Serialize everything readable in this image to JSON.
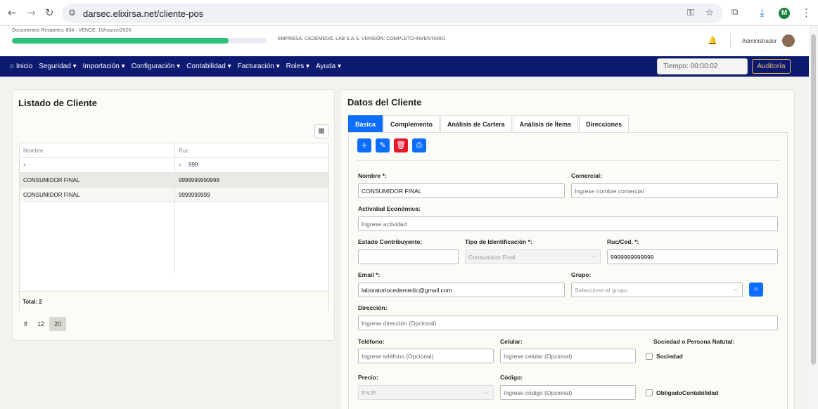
{
  "browser": {
    "url": "darsec.elixirsa.net/cliente-pos",
    "profile_initial": "M"
  },
  "header": {
    "docs_text": "Documentos Restantes: 834 - VENCE: 10/marzo/2026",
    "progress": 0.85,
    "empresa_text": "EMPRESA: CEDEMEDIC LAB S.A.S. VERSIÓN: COMPLETO-INVENTARIO",
    "user": "Administrador"
  },
  "nav": {
    "items": [
      "Inicio",
      "Seguridad",
      "Importación",
      "Configuración",
      "Contabilidad",
      "Facturación",
      "Roles",
      "Ayuda"
    ],
    "timer": "Tiempo: 00:00:02",
    "audit_label": "Auditoría"
  },
  "list": {
    "title": "Listado de Cliente",
    "columns": [
      "Nombre",
      "Ruc"
    ],
    "filter_ruc": "999",
    "rows": [
      {
        "nombre": "CONSUMIDOR FINAL",
        "ruc": "9999999999999"
      },
      {
        "nombre": "CONSUMIDOR FINAL",
        "ruc": "9999999999"
      }
    ],
    "total": "Total: 2",
    "page_sizes": [
      "8",
      "12",
      "20"
    ]
  },
  "form": {
    "title": "Datos del Cliente",
    "tabs": [
      "Básica",
      "Complemento",
      "Análisis de Cartera",
      "Análisis de Ítems",
      "Direcciones"
    ],
    "labels": {
      "nombre": "Nombre *:",
      "comercial": "Comercial:",
      "actividad": "Actividad Económica:",
      "estado": "Estado Contribuyente:",
      "tipo_id": "Tipo de Identificación *:",
      "ruc": "Ruc/Ced. *:",
      "email": "Email *:",
      "grupo": "Grupo:",
      "direccion": "Dirección:",
      "telefono": "Teléfono:",
      "celular": "Celular:",
      "sociedad_title": "Sociedad o Persona Natutal:",
      "sociedad": "Sociedad",
      "precio": "Precio:",
      "codigo": "Código:",
      "obligado": "ObligadoContabilidad"
    },
    "values": {
      "nombre": "CONSUMIDOR FINAL",
      "tipo_id": "Consumidor Final",
      "ruc": "9999999999999",
      "email": "laboratoriocedemedic@gmail.com",
      "precio": "P.V.P."
    },
    "placeholders": {
      "comercial": "Ingrese nombre comercial",
      "actividad": "Ingrese actividad",
      "grupo": "Seleccione el grupo",
      "direccion": "Ingrese dirección (Opcional)",
      "telefono": "Ingrese teléfono (Opcional)",
      "celular": "Ingrese celular (Opcional)",
      "codigo": "Ingrese código (Opcional)"
    }
  }
}
